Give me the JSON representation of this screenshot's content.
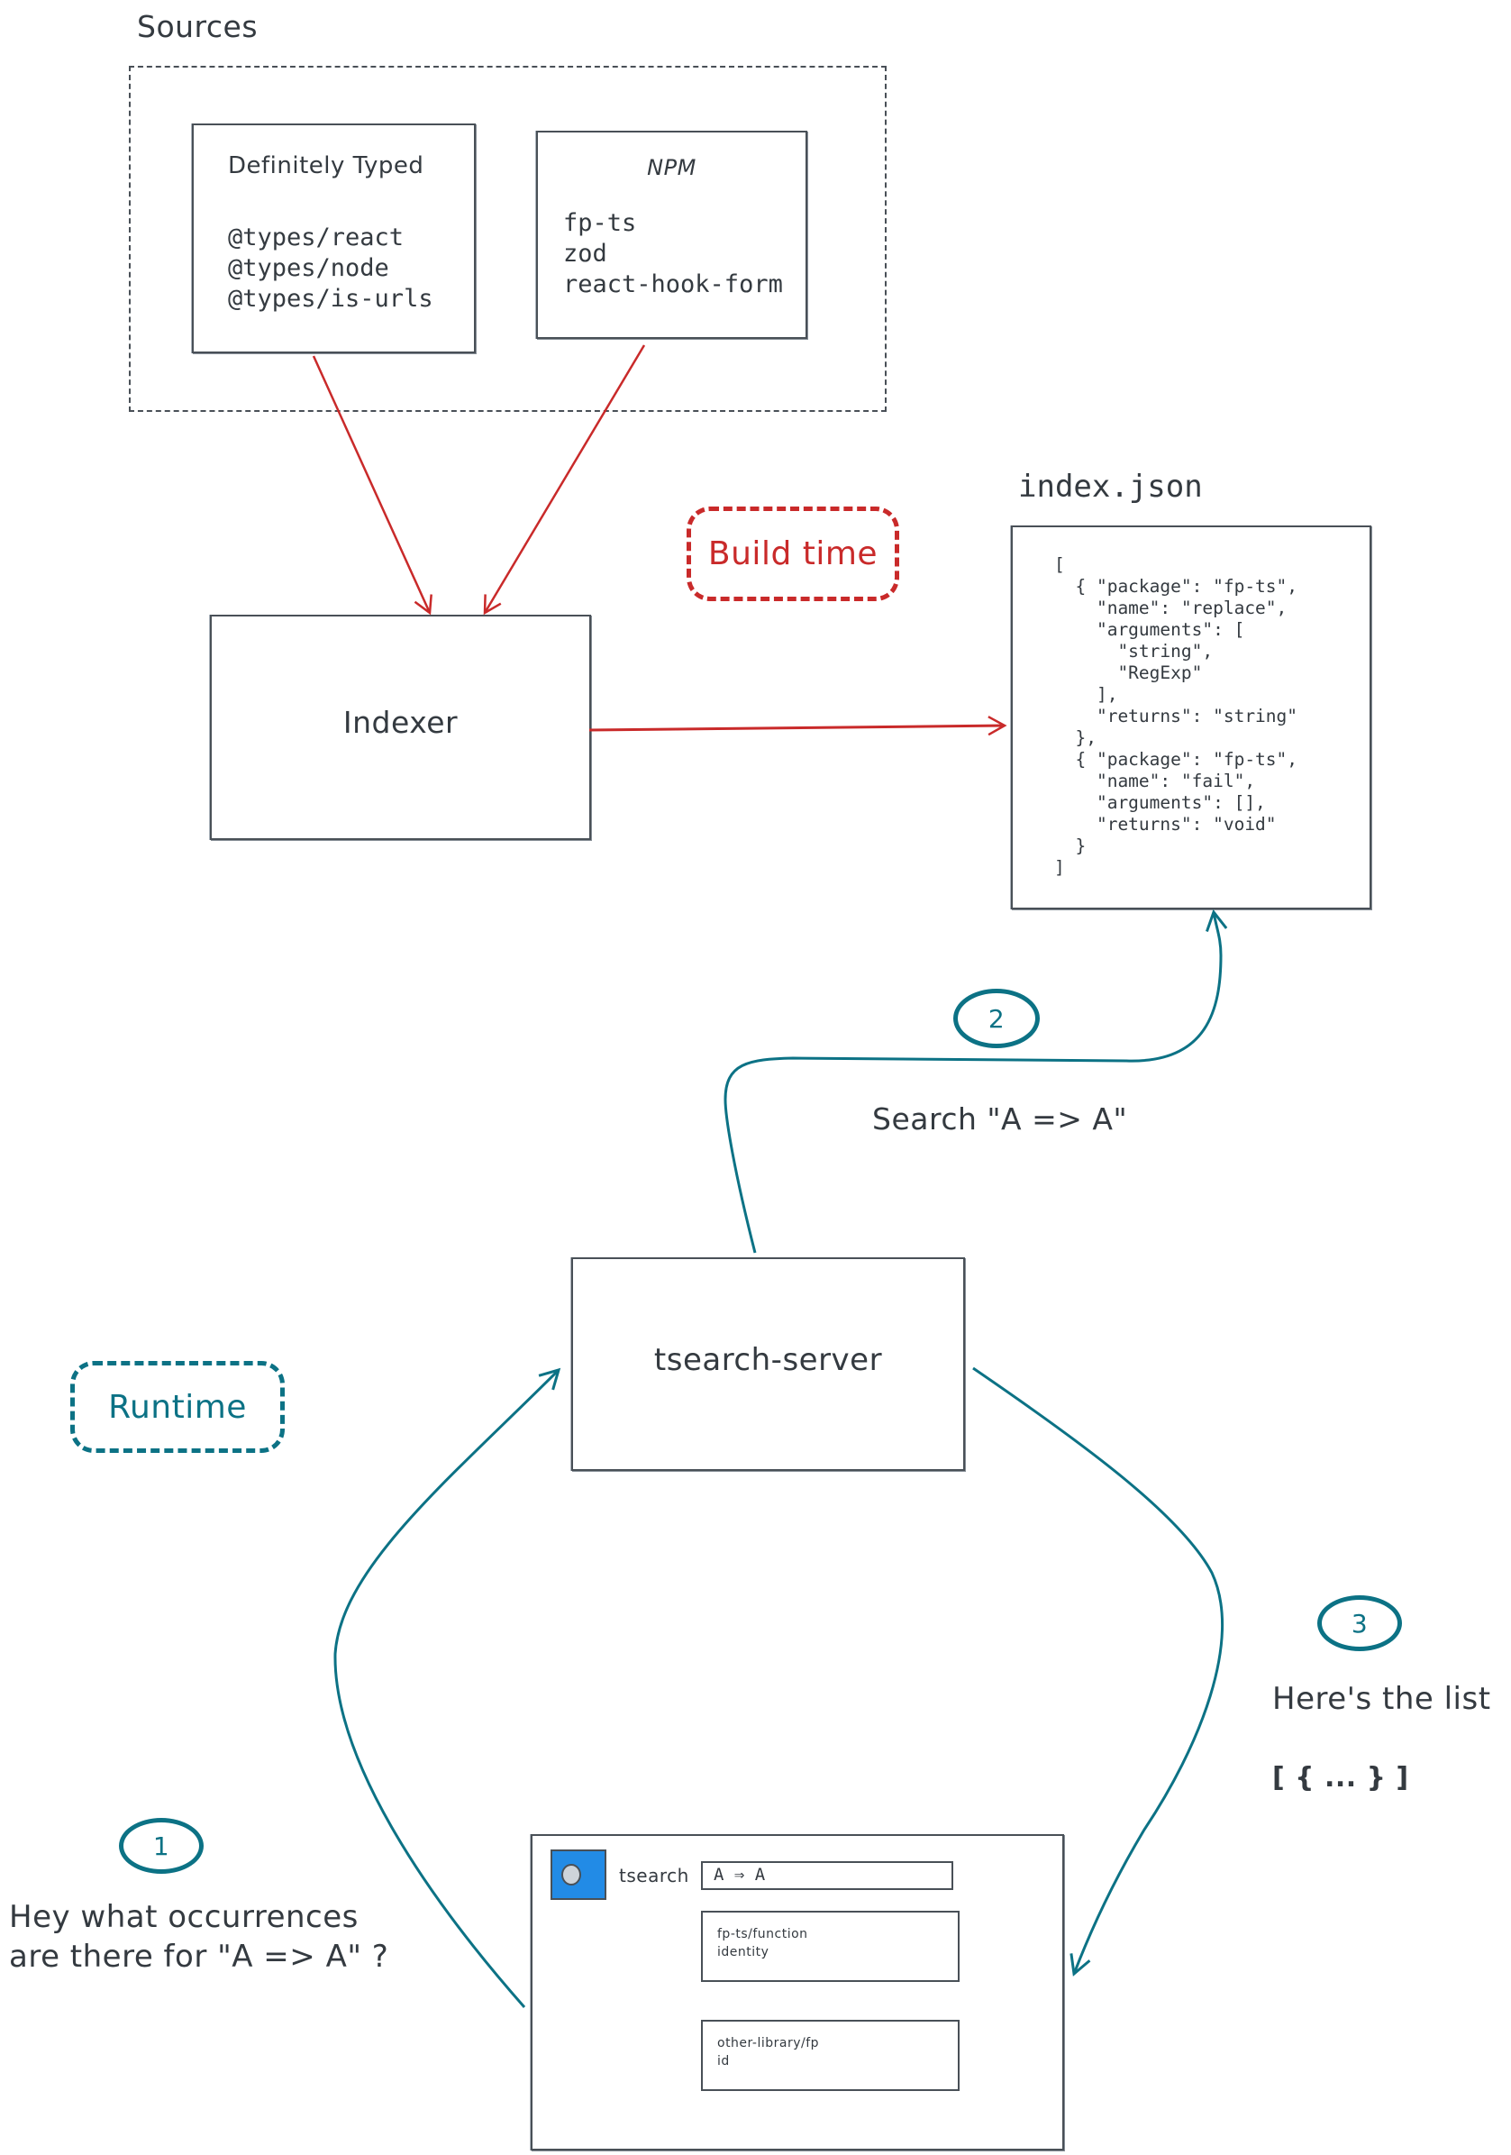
{
  "colors": {
    "build": "#c92a2a",
    "runtime": "#0c7285",
    "ink": "#343a40",
    "logo": "#228be6"
  },
  "sources": {
    "title": "Sources",
    "definitely_typed": {
      "title": "Definitely Typed",
      "items": [
        "@types/react",
        "@types/node",
        "@types/is-urls"
      ]
    },
    "npm": {
      "title": "NPM",
      "items": [
        "fp-ts",
        "zod",
        "react-hook-form"
      ]
    }
  },
  "indexer": {
    "label": "Indexer"
  },
  "build_time": {
    "label": "Build time"
  },
  "index_json": {
    "title": "index.json",
    "code": "[\n  { \"package\": \"fp-ts\",\n    \"name\": \"replace\",\n    \"arguments\": [\n      \"string\",\n      \"RegExp\"\n    ],\n    \"returns\": \"string\"\n  },\n  { \"package\": \"fp-ts\",\n    \"name\": \"fail\",\n    \"arguments\": [],\n    \"returns\": \"void\"\n  }\n]"
  },
  "step2": {
    "number": "2",
    "label": "Search \"A => A\""
  },
  "server": {
    "label": "tsearch-server"
  },
  "runtime": {
    "label": "Runtime"
  },
  "step1": {
    "number": "1",
    "label_lines": [
      "Hey what occurrences",
      "are there for \"A => A\" ?"
    ]
  },
  "step3": {
    "number": "3",
    "label": "Here's the list",
    "payload": "[ { ... } ]"
  },
  "app_mock": {
    "brand": "tsearch",
    "search_value": "A ⇒ A",
    "results": [
      {
        "module": "fp-ts/function",
        "name": "identity"
      },
      {
        "module": "other-library/fp",
        "name": "id"
      }
    ]
  }
}
